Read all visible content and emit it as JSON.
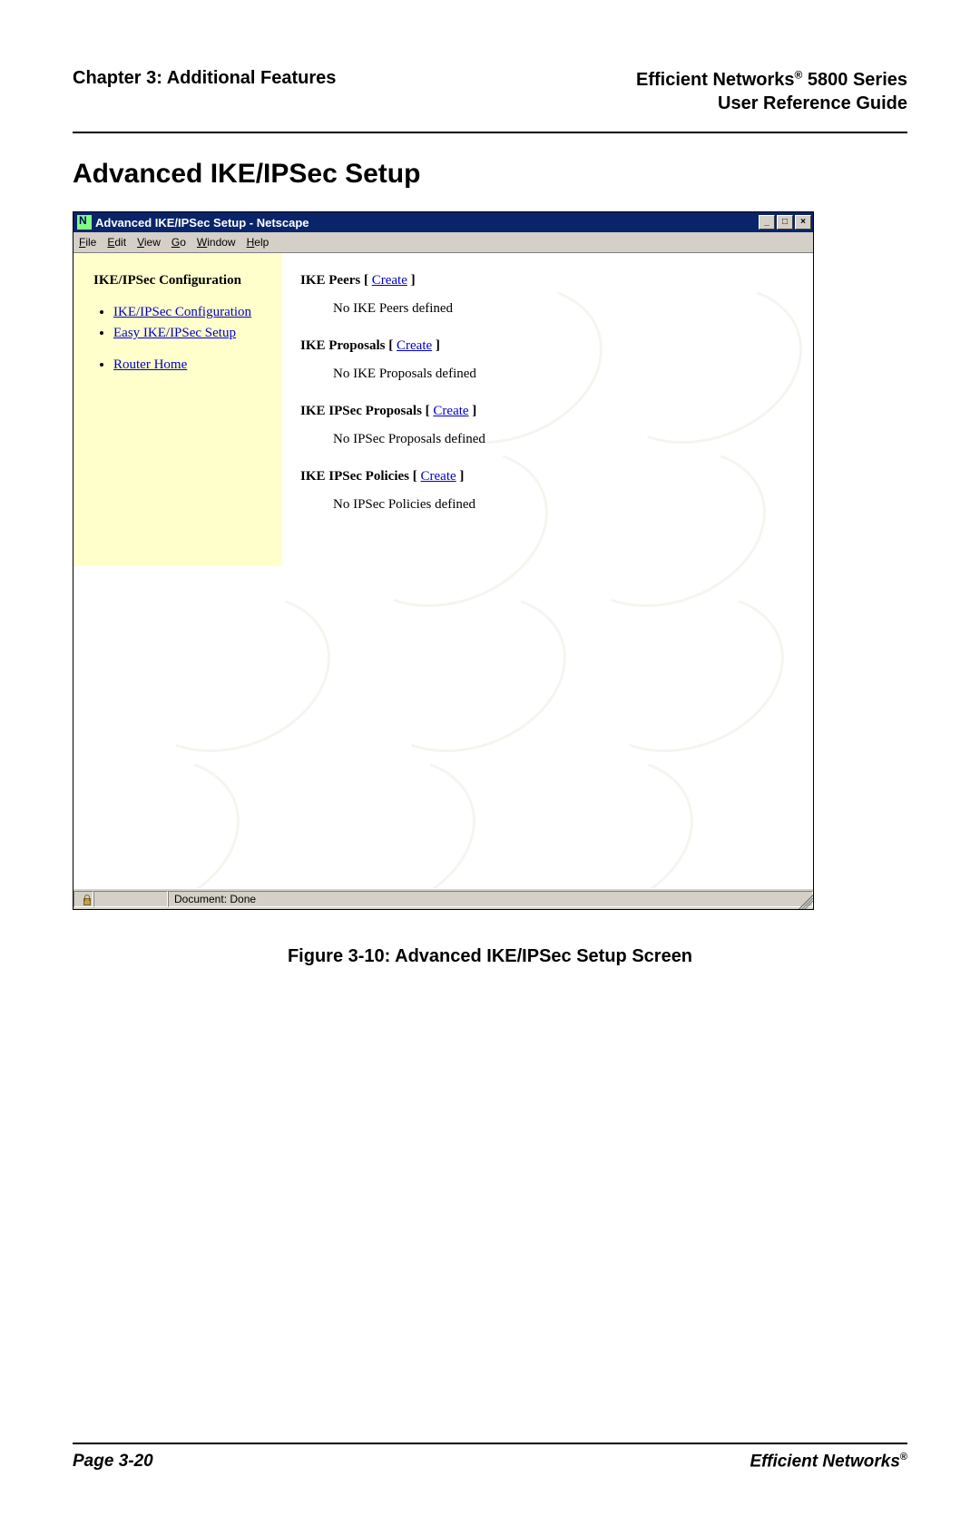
{
  "header": {
    "chapter": "Chapter 3: Additional Features",
    "brand1": "Efficient Networks",
    "reg": "®",
    "brand2": " 5800 Series",
    "subtitle": "User Reference Guide"
  },
  "section_title": "Advanced IKE/IPSec Setup",
  "window": {
    "title": "Advanced IKE/IPSec Setup - Netscape",
    "min": "_",
    "max": "□",
    "close": "×"
  },
  "menu": {
    "file": "File",
    "edit": "Edit",
    "view": "View",
    "go": "Go",
    "window": "Window",
    "help": "Help"
  },
  "sidebar": {
    "title": "IKE/IPSec Configuration",
    "item1": "IKE/IPSec Configuration",
    "item2": "Easy IKE/IPSec Setup",
    "item3": "Router Home"
  },
  "main": {
    "peers_head": "IKE Peers",
    "peers_msg": "No IKE Peers defined",
    "proposals_head": "IKE Proposals",
    "proposals_msg": "No IKE Proposals defined",
    "ipsec_prop_head": "IKE IPSec Proposals",
    "ipsec_prop_msg": "No IPSec Proposals defined",
    "ipsec_pol_head": "IKE IPSec Policies",
    "ipsec_pol_msg": "No IPSec Policies defined",
    "create": "Create",
    "lb": " [ ",
    "rb": " ]"
  },
  "status": {
    "text": "Document: Done"
  },
  "caption": "Figure 3-10:  Advanced IKE/IPSec Setup Screen",
  "footer": {
    "page": "Page 3-20",
    "brand": "Efficient Networks",
    "reg": "®"
  }
}
